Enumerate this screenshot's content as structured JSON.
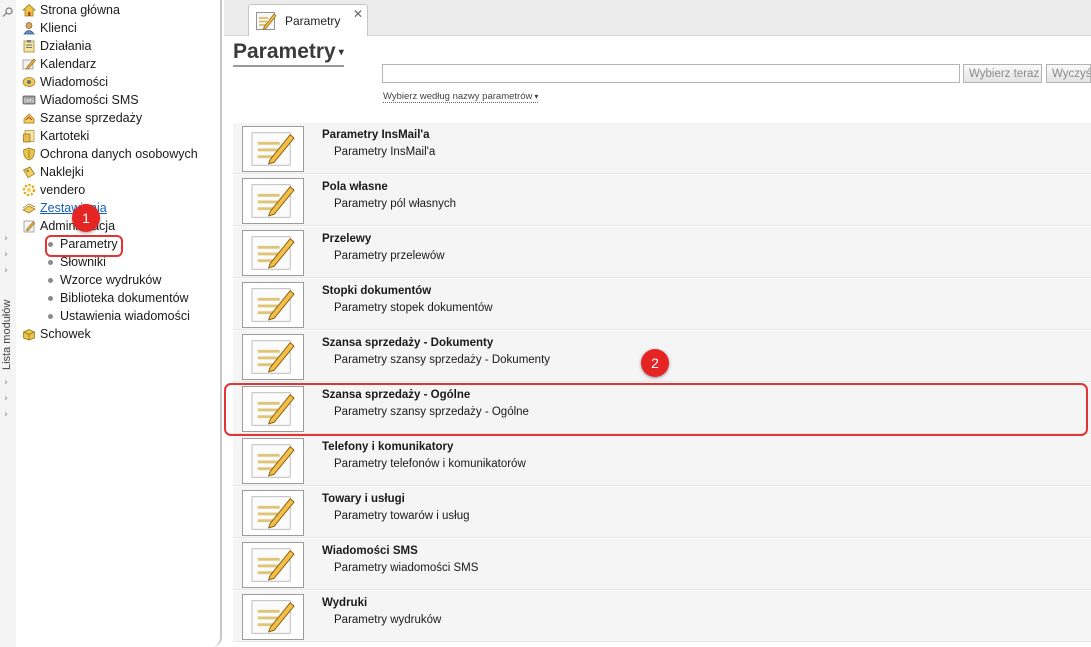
{
  "rail": {
    "vertical_label": "Lista modułów"
  },
  "sidebar": {
    "items": [
      {
        "label": "Strona główna",
        "icon": "home-icon"
      },
      {
        "label": "Klienci",
        "icon": "person-icon"
      },
      {
        "label": "Działania",
        "icon": "clipboard-icon"
      },
      {
        "label": "Kalendarz",
        "icon": "pencil-icon"
      },
      {
        "label": "Wiadomości",
        "icon": "messages-icon"
      },
      {
        "label": "Wiadomości SMS",
        "icon": "sms-icon"
      },
      {
        "label": "Szanse sprzedaży",
        "icon": "sales-icon"
      },
      {
        "label": "Kartoteki",
        "icon": "cards-icon"
      },
      {
        "label": "Ochrona danych osobowych",
        "icon": "shield-icon"
      },
      {
        "label": "Naklejki",
        "icon": "sticker-icon"
      },
      {
        "label": "vendero",
        "icon": "gear-icon"
      },
      {
        "label": "Zestawienia",
        "icon": "chart-icon"
      },
      {
        "label": "Administracja",
        "icon": "admin-icon"
      },
      {
        "label": "Schowek",
        "icon": "box-icon"
      }
    ],
    "admin_subitems": [
      {
        "label": "Parametry"
      },
      {
        "label": "Słowniki"
      },
      {
        "label": "Wzorce wydruków"
      },
      {
        "label": "Biblioteka dokumentów"
      },
      {
        "label": "Ustawienia wiadomości"
      }
    ]
  },
  "annotations": {
    "badge1": "1",
    "badge2": "2",
    "color": "#e53333"
  },
  "tab": {
    "label": "Parametry",
    "close": "✕"
  },
  "main": {
    "title": "Parametry",
    "title_caret": "▾",
    "search_value": "",
    "select_button": "Wybierz teraz",
    "clear_button": "Wyczyść",
    "filter_link": "Wybierz według nazwy parametrów",
    "filter_caret": "▾",
    "params": [
      {
        "name": "Parametry InsMail'a",
        "desc": "Parametry InsMail'a"
      },
      {
        "name": "Pola własne",
        "desc": "Parametry pól własnych"
      },
      {
        "name": "Przelewy",
        "desc": "Parametry przelewów"
      },
      {
        "name": "Stopki dokumentów",
        "desc": "Parametry stopek dokumentów"
      },
      {
        "name": "Szansa sprzedaży - Dokumenty",
        "desc": "Parametry szansy sprzedaży - Dokumenty"
      },
      {
        "name": "Szansa sprzedaży - Ogólne",
        "desc": "Parametry szansy sprzedaży - Ogólne"
      },
      {
        "name": "Telefony i komunikatory",
        "desc": "Parametry telefonów i komunikatorów"
      },
      {
        "name": "Towary i usługi",
        "desc": "Parametry towarów i usług"
      },
      {
        "name": "Wiadomości SMS",
        "desc": "Parametry wiadomości SMS"
      },
      {
        "name": "Wydruki",
        "desc": "Parametry wydruków"
      }
    ]
  }
}
